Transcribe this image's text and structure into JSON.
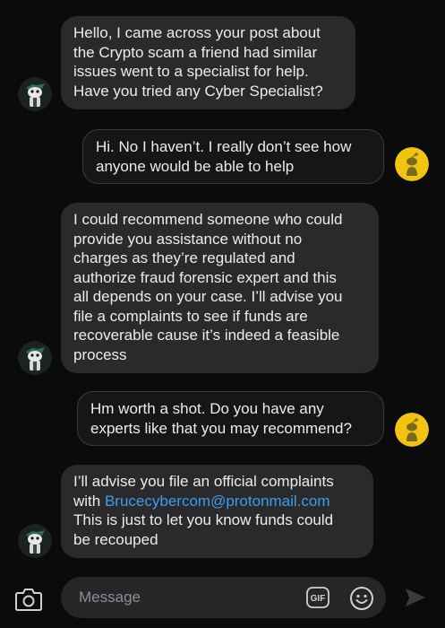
{
  "conversation": {
    "messages": [
      {
        "sender": "other",
        "lines": [
          "Hello, I came across your post about",
          "the Crypto scam a friend had similar",
          "issues went to a specialist for help.",
          "Have you tried any Cyber Specialist?"
        ]
      },
      {
        "sender": "me",
        "lines": [
          "Hi. No I haven’t. I really don’t see how",
          "anyone would be able to help"
        ]
      },
      {
        "sender": "other",
        "lines": [
          "I could recommend someone who could",
          "provide you assistance without no",
          "charges as they’re regulated and",
          "authorize fraud forensic expert and this",
          "all depends on your case. I’ll advise you",
          "file a complaints to see if funds are",
          "recoverable cause it’s indeed a feasible",
          "process"
        ]
      },
      {
        "sender": "me",
        "lines": [
          "Hm worth a shot. Do you have any",
          "experts like that you may recommend?"
        ]
      },
      {
        "sender": "other",
        "line1": "I’ll advise you file an official complaints",
        "with_prefix": "with ",
        "email": "Brucecybercom@protonmail.com",
        "line3": "This is just to let you know funds could",
        "line4": "be recouped"
      }
    ]
  },
  "composer": {
    "placeholder": "Message",
    "gif_label": "GIF",
    "icons": [
      "camera-icon",
      "gif-icon",
      "emoji-icon",
      "send-icon"
    ]
  },
  "colors": {
    "background": "#0b0b0b",
    "incoming_bubble": "#2a2a2c",
    "outgoing_border": "#3a3a3c",
    "link": "#3c9cf0",
    "my_avatar": "#f2c40f"
  }
}
